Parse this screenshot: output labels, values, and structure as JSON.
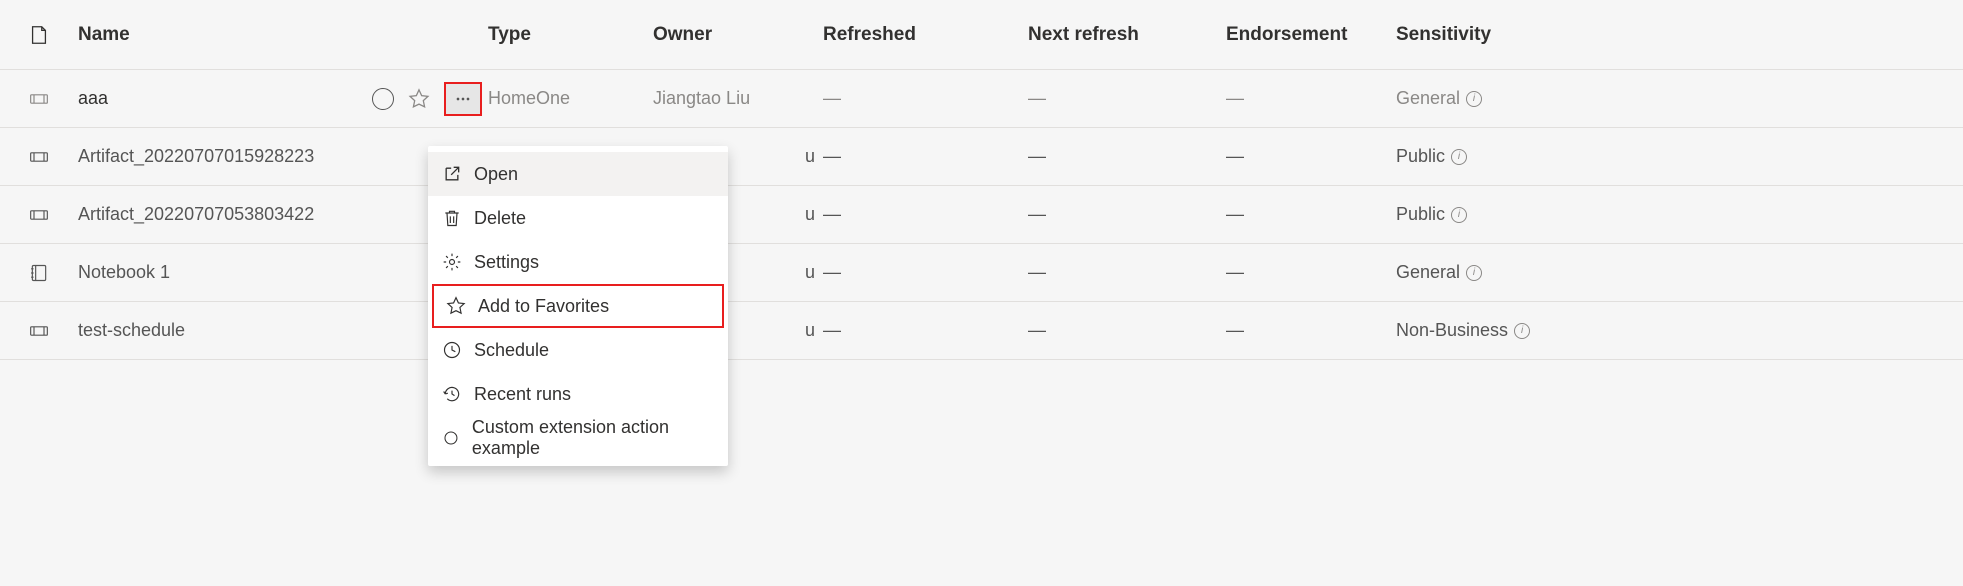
{
  "columns": {
    "name": "Name",
    "type": "Type",
    "owner": "Owner",
    "refreshed": "Refreshed",
    "next_refresh": "Next refresh",
    "endorsement": "Endorsement",
    "sensitivity": "Sensitivity"
  },
  "icons": {
    "page": "page-icon",
    "pipeline": "pipeline-icon",
    "notebook": "notebook-icon"
  },
  "rows": [
    {
      "name": "aaa",
      "type": "HomeOne",
      "owner": "Jiangtao Liu",
      "refreshed": "—",
      "next_refresh": "—",
      "endorsement": "—",
      "sensitivity": "General",
      "icon": "pipeline",
      "hover": true
    },
    {
      "name": "Artifact_20220707015928223",
      "type": "",
      "owner": "u",
      "refreshed": "—",
      "next_refresh": "—",
      "endorsement": "—",
      "sensitivity": "Public",
      "icon": "pipeline"
    },
    {
      "name": "Artifact_20220707053803422",
      "type": "",
      "owner": "u",
      "refreshed": "—",
      "next_refresh": "—",
      "endorsement": "—",
      "sensitivity": "Public",
      "icon": "pipeline"
    },
    {
      "name": "Notebook 1",
      "type": "",
      "owner": "u",
      "refreshed": "—",
      "next_refresh": "—",
      "endorsement": "—",
      "sensitivity": "General",
      "icon": "notebook"
    },
    {
      "name": "test-schedule",
      "type": "",
      "owner": "u",
      "refreshed": "—",
      "next_refresh": "—",
      "endorsement": "—",
      "sensitivity": "Non-Business",
      "icon": "pipeline"
    }
  ],
  "context_menu": {
    "open": "Open",
    "delete": "Delete",
    "settings": "Settings",
    "add_fav": "Add to Favorites",
    "schedule": "Schedule",
    "recent_runs": "Recent runs",
    "custom": "Custom extension action example"
  }
}
